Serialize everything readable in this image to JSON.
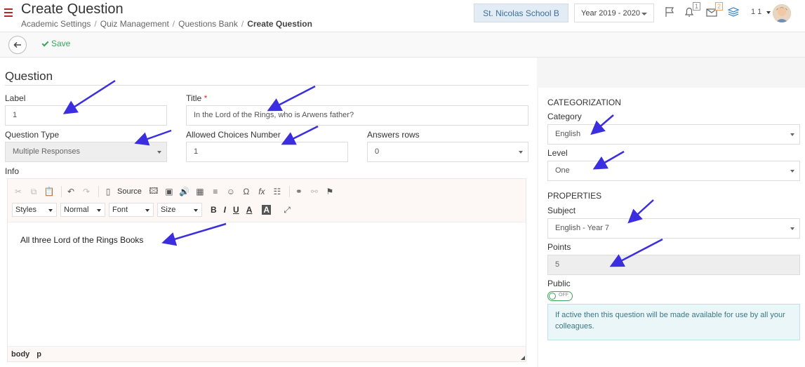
{
  "header": {
    "title": "Create Question",
    "breadcrumb": [
      "Academic Settings",
      "Quiz Management",
      "Questions Bank",
      "Create Question"
    ],
    "breadcrumb_sep": "/",
    "school": "St. Nicolas School B",
    "year": "Year 2019 - 2020",
    "notif_count": "1",
    "message_count": "2",
    "user_label": "1 1"
  },
  "actions": {
    "save_label": "Save"
  },
  "form": {
    "section_title": "Question",
    "label_label": "Label",
    "label_value": "1",
    "title_label": "Title",
    "title_required": "*",
    "title_value": "In the Lord of the Rings, who is Arwens father?",
    "question_type_label": "Question Type",
    "question_type_value": "Multiple Responses",
    "allowed_choices_label": "Allowed Choices Number",
    "allowed_choices_value": "1",
    "answers_rows_label": "Answers rows",
    "answers_rows_value": "0",
    "info_label": "Info"
  },
  "editor": {
    "source_label": "Source",
    "styles": "Styles",
    "format": "Normal",
    "font": "Font",
    "size": "Size",
    "bold": "B",
    "italic": "I",
    "underline": "U",
    "text_color": "A",
    "bg_color": "A",
    "content": "All three Lord of the Rings Books",
    "path": [
      "body",
      "p"
    ]
  },
  "categorization": {
    "heading": "CATEGORIZATION",
    "category_label": "Category",
    "category_value": "English",
    "level_label": "Level",
    "level_value": "One"
  },
  "properties": {
    "heading": "PROPERTIES",
    "subject_label": "Subject",
    "subject_value": "English - Year 7",
    "points_label": "Points",
    "points_value": "5",
    "public_label": "Public",
    "public_toggle": "OFF",
    "public_on": false,
    "info_text": "If active then this question will be made available for use by all your colleagues."
  },
  "colors": {
    "accent_red": "#b02a2a",
    "save_green": "#3aa55c",
    "arrow_blue": "#3b2ee0",
    "info_bg": "#eaf6f8"
  }
}
